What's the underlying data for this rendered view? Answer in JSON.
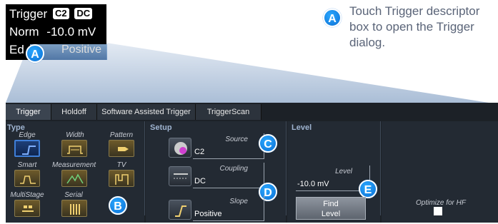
{
  "descriptor": {
    "title": "Trigger",
    "chip1": "C2",
    "chip2": "DC",
    "mode": "Norm",
    "level": "-10.0 mV",
    "type_fragment": "Ed",
    "slope": "Positive"
  },
  "callouts": {
    "a": "A",
    "b": "B",
    "c": "C",
    "d": "D",
    "e": "E"
  },
  "note": "Touch Trigger descriptor box to open the Trigger dialog.",
  "tabs": [
    "Trigger",
    "Holdoff",
    "Software Assisted Trigger",
    "TriggerScan"
  ],
  "type_section": {
    "title": "Type",
    "items": [
      "Edge",
      "Width",
      "Pattern",
      "Smart",
      "Measurement",
      "TV",
      "MultiStage",
      "Serial"
    ]
  },
  "setup": {
    "title": "Setup",
    "source_label": "Source",
    "source_value": "C2",
    "coupling_label": "Coupling",
    "coupling_value": "DC",
    "slope_label": "Slope",
    "slope_value": "Positive"
  },
  "level_section": {
    "title": "Level",
    "level_label": "Level",
    "level_value": "-10.0 mV",
    "find_line1": "Find",
    "find_line2": "Level"
  },
  "optimize_label": "Optimize for HF",
  "colors": {
    "accent": "#0b6fd4",
    "dialog_bg": "#232a33",
    "selected_border": "#3f7fd8"
  }
}
